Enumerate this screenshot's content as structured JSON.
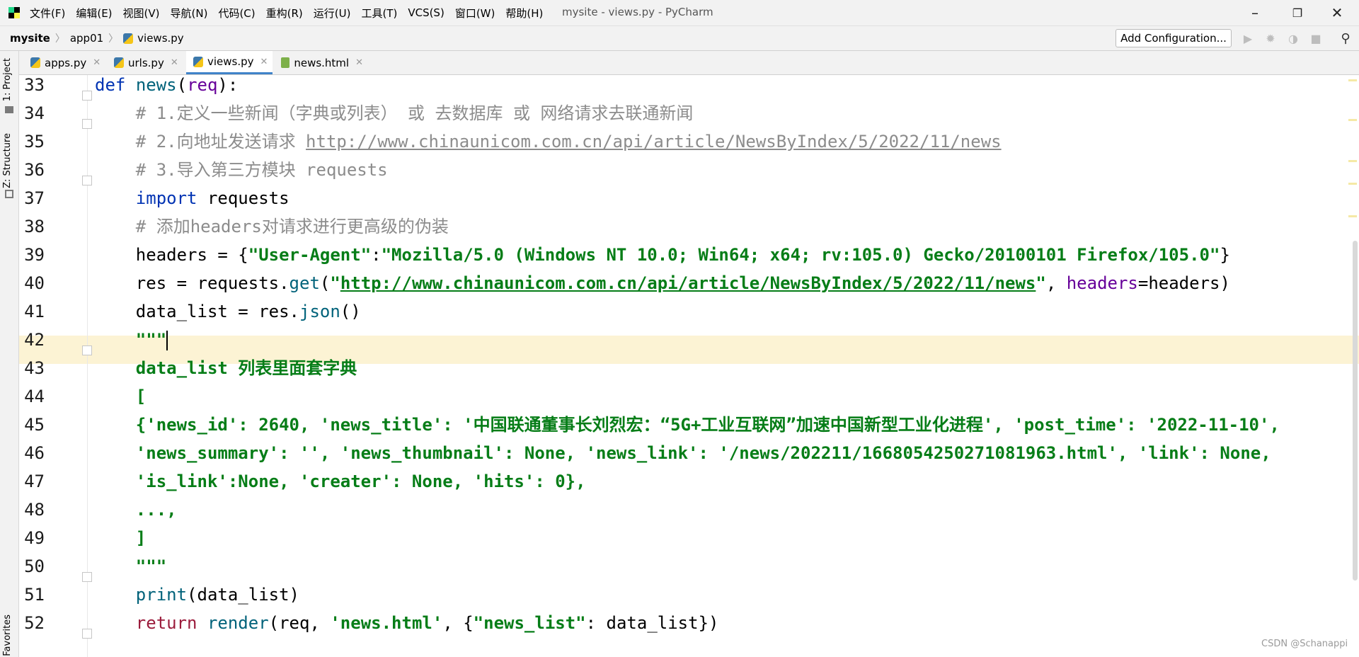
{
  "menu": {
    "items": [
      "文件(F)",
      "编辑(E)",
      "视图(V)",
      "导航(N)",
      "代码(C)",
      "重构(R)",
      "运行(U)",
      "工具(T)",
      "VCS(S)",
      "窗口(W)",
      "帮助(H)"
    ],
    "window_title": "mysite - views.py - PyCharm"
  },
  "nav": {
    "breadcrumb": [
      "mysite",
      "app01",
      "views.py"
    ],
    "add_configuration": "Add Configuration..."
  },
  "side_tabs": {
    "project": "1: Project",
    "structure": "Z: Structure",
    "favorites": "Favorites"
  },
  "tabs": [
    {
      "label": "apps.py",
      "active": false
    },
    {
      "label": "urls.py",
      "active": false
    },
    {
      "label": "views.py",
      "active": true
    },
    {
      "label": "news.html",
      "active": false
    }
  ],
  "editor": {
    "line_numbers": [
      "33",
      "34",
      "35",
      "36",
      "37",
      "38",
      "39",
      "40",
      "41",
      "42",
      "43",
      "44",
      "45",
      "46",
      "47",
      "48",
      "49",
      "50",
      "51",
      "52"
    ],
    "current_line": "42",
    "lines": {
      "l33": {
        "kw": "def",
        "fn": "news",
        "p1": "(",
        "arg": "req",
        "p2": "):"
      },
      "l34": {
        "comment": "# 1.定义一些新闻（字典或列表） 或 去数据库 或 网络请求去联通新闻"
      },
      "l35": {
        "comment": "# 2.向地址发送请求 ",
        "url": "http://www.chinaunicom.com.cn/api/article/NewsByIndex/5/2022/11/news"
      },
      "l36": {
        "comment": "# 3.导入第三方模块 requests"
      },
      "l37": {
        "kw": "import",
        "rest": " requests"
      },
      "l38": {
        "comment": "# 添加headers对请求进行更高级的伪装"
      },
      "l39": {
        "a": "headers ",
        "op": "=",
        "b": " {",
        "k": "\"User-Agent\"",
        "c": ":",
        "v": "\"Mozilla/5.0 (Windows NT 10.0; Win64; x64; rv:105.0) Gecko/20100101 Firefox/105.0\"",
        "d": "}"
      },
      "l40": {
        "a": "res = requests.",
        "m": "get",
        "b": "(",
        "q1": "\"",
        "url": "http://www.chinaunicom.com.cn/api/article/NewsByIndex/5/2022/11/news",
        "q2": "\"",
        "c": ", ",
        "kwarg": "headers",
        "d": "=headers)"
      },
      "l41": {
        "a": "data_list ",
        "op": "=",
        "b": " res.",
        "m": "json",
        "c": "()"
      },
      "l42": {
        "doc": "\"\"\""
      },
      "l43": {
        "doc": "data_list 列表里面套字典"
      },
      "l44": {
        "doc": "["
      },
      "l45": {
        "doc": "{'news_id': 2640, 'news_title': '中国联通董事长刘烈宏：“5G+工业互联网”加速中国新型工业化进程', 'post_time': '2022-11-10',"
      },
      "l46": {
        "doc": "'news_summary': '', 'news_thumbnail': None, 'news_link': '/news/202211/1668054250271081963.html', 'link': None,"
      },
      "l47": {
        "doc": "'is_link':None, 'creater': None, 'hits': 0},"
      },
      "l48": {
        "doc": "...,"
      },
      "l49": {
        "doc": "]"
      },
      "l50": {
        "doc": "\"\"\""
      },
      "l51": {
        "fn": "print",
        "rest": "(data_list)"
      },
      "l52": {
        "kw": "return",
        "fn": " render",
        "a": "(req, ",
        "s1": "'news.html'",
        "b": ", {",
        "s2": "\"news_list\"",
        "c": ": data_list})"
      }
    }
  },
  "watermark": "CSDN @Schanappi"
}
